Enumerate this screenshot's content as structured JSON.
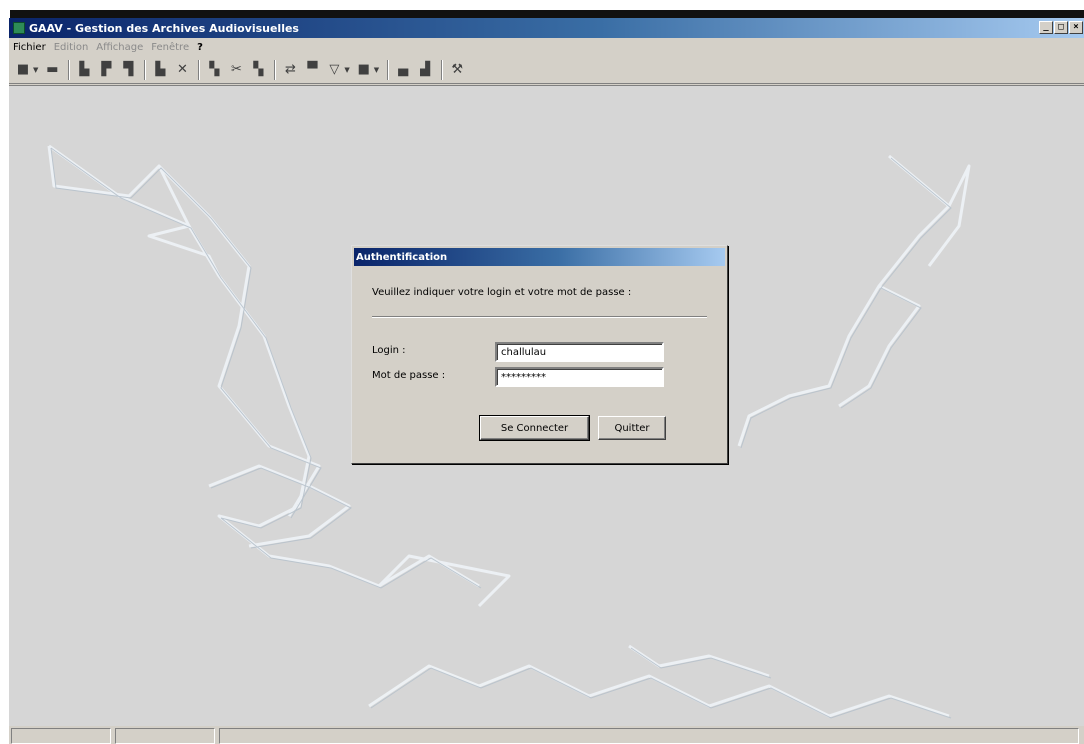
{
  "window": {
    "title": "GAAV - Gestion des Archives Audiovisuelles",
    "controls": [
      "_",
      "□",
      "×"
    ]
  },
  "menu": {
    "items": [
      {
        "label": "Fichier",
        "enabled": true
      },
      {
        "label": "Edition",
        "enabled": false
      },
      {
        "label": "Affichage",
        "enabled": false
      },
      {
        "label": "Fenêtre",
        "enabled": false
      },
      {
        "label": "?",
        "enabled": true
      }
    ]
  },
  "toolbar": {
    "icons": [
      "new-icon",
      "open-icon",
      "print-icon",
      "document-icon",
      "stack-icon",
      "edit-icon",
      "delete-icon",
      "copy-icon",
      "cut-icon",
      "paste-icon",
      "refresh-icon",
      "folder-icon",
      "filter-icon",
      "list-icon",
      "archive-icon",
      "stamp-icon",
      "tools-icon"
    ]
  },
  "dialog": {
    "title": "Authentification",
    "instruction": "Veuillez indiquer votre login et votre mot de passe :",
    "login_label": "Login :",
    "login_value": "challulau",
    "password_label": "Mot de passe :",
    "password_value": "*********",
    "connect_label": "Se Connecter",
    "quit_label": "Quitter"
  },
  "colors": {
    "titlebar_start": "#0a246a",
    "titlebar_end": "#a6caf0",
    "face": "#d4d0c8",
    "client": "#d6d6d6"
  }
}
